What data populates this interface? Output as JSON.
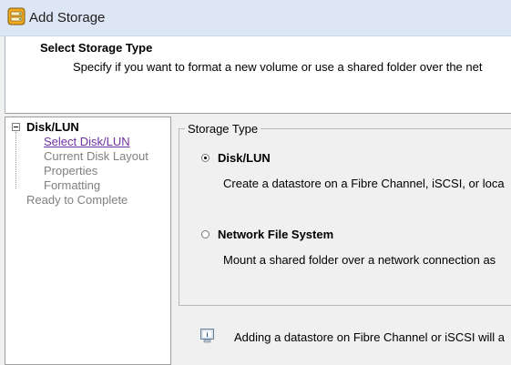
{
  "window": {
    "title": "Add Storage",
    "icon": "storage-app-icon"
  },
  "header": {
    "title": "Select Storage Type",
    "subtitle": "Specify if you want to format a new volume or use a shared folder over the net"
  },
  "nav": {
    "root": "Disk/LUN",
    "items": [
      {
        "label": "Select Disk/LUN",
        "state": "active"
      },
      {
        "label": "Current Disk Layout",
        "state": "pending"
      },
      {
        "label": "Properties",
        "state": "pending"
      },
      {
        "label": "Formatting",
        "state": "pending"
      }
    ],
    "final": "Ready to Complete"
  },
  "storage_type": {
    "legend": "Storage Type",
    "options": [
      {
        "label": "Disk/LUN",
        "description": "Create a datastore on a Fibre Channel, iSCSI, or loca",
        "selected": true
      },
      {
        "label": "Network File System",
        "description": "Mount a shared folder over a network connection as",
        "selected": false
      }
    ]
  },
  "info": {
    "icon": "info-icon",
    "text": "Adding a datastore on Fibre Channel or iSCSI will a"
  },
  "colors": {
    "titlebar": "#dce6f4",
    "active_link": "#7030a0",
    "pending_text": "#808080"
  }
}
